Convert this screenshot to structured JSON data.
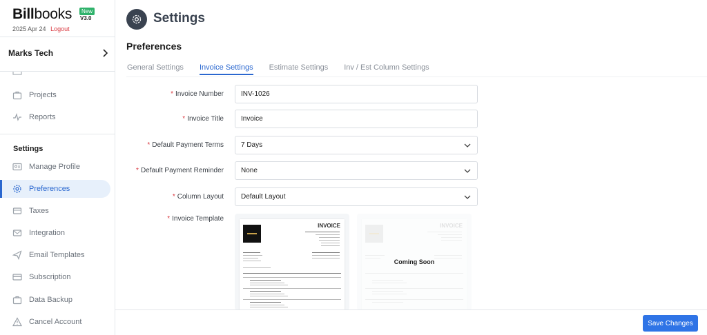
{
  "brand": {
    "name_bold": "Bill",
    "name_light": "books",
    "badge": "New",
    "version": "V3.0"
  },
  "user": {
    "date": "2025 Apr 24",
    "logout": "Logout"
  },
  "company": {
    "name": "Marks Tech"
  },
  "sidebar": {
    "top_items": [
      {
        "label": "Projects",
        "icon": "briefcase-icon"
      },
      {
        "label": "Reports",
        "icon": "pulse-icon"
      }
    ],
    "settings_heading": "Settings",
    "settings_items": [
      {
        "label": "Manage Profile",
        "icon": "id-card-icon"
      },
      {
        "label": "Preferences",
        "icon": "gear-icon",
        "active": true
      },
      {
        "label": "Taxes",
        "icon": "receipt-icon"
      },
      {
        "label": "Integration",
        "icon": "mail-icon"
      },
      {
        "label": "Email Templates",
        "icon": "send-icon"
      },
      {
        "label": "Subscription",
        "icon": "card-icon"
      },
      {
        "label": "Data Backup",
        "icon": "bag-icon"
      },
      {
        "label": "Cancel Account",
        "icon": "warning-icon"
      }
    ]
  },
  "header": {
    "title": "Settings"
  },
  "preferences": {
    "title": "Preferences",
    "tabs": [
      "General Settings",
      "Invoice Settings",
      "Estimate Settings",
      "Inv / Est Column Settings"
    ],
    "active_tab": "Invoice Settings"
  },
  "form": {
    "invoice_number": {
      "label": "Invoice Number",
      "value": "INV-1026"
    },
    "invoice_title": {
      "label": "Invoice Title",
      "value": "Invoice"
    },
    "payment_terms": {
      "label": "Default Payment Terms",
      "value": "7 Days"
    },
    "payment_reminder": {
      "label": "Default Payment Reminder",
      "value": "None"
    },
    "column_layout": {
      "label": "Column Layout",
      "value": "Default Layout"
    },
    "template": {
      "label": "Invoice Template",
      "thumb_title": "INVOICE",
      "coming_soon": "Coming Soon"
    }
  },
  "footer": {
    "save_label": "Save Changes"
  },
  "colors": {
    "accent": "#2a67cf",
    "button": "#2f74e6",
    "required": "#d9363e",
    "new_badge": "#2fb26b"
  }
}
